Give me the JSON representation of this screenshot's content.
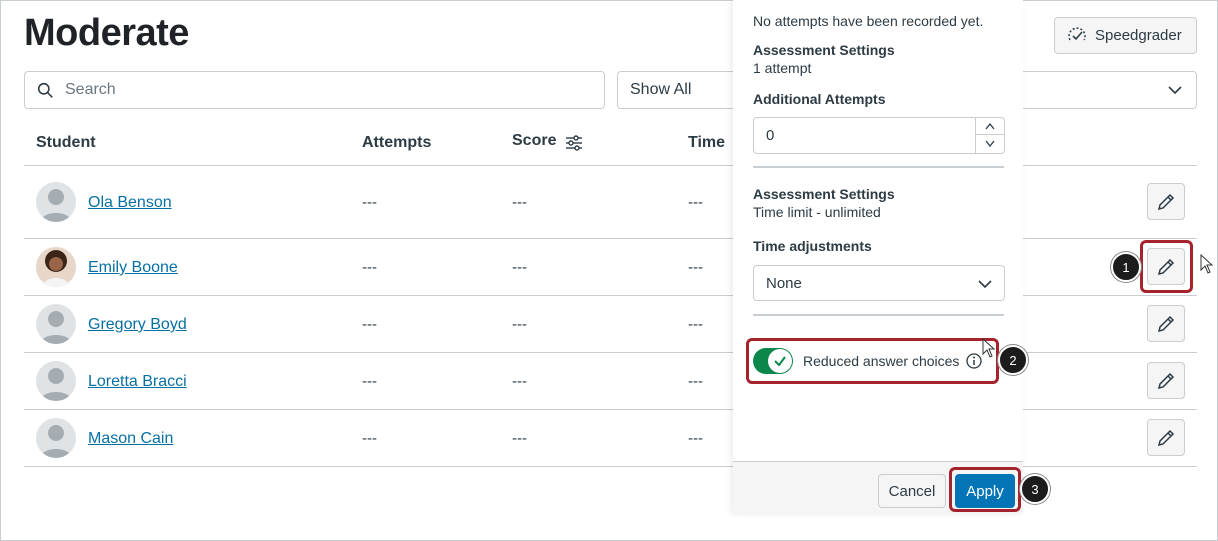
{
  "page": {
    "title": "Moderate"
  },
  "search": {
    "placeholder": "Search"
  },
  "filter": {
    "selected": "Show All"
  },
  "speedgrader": {
    "label": "Speedgrader"
  },
  "table": {
    "headers": {
      "student": "Student",
      "attempts": "Attempts",
      "score": "Score",
      "time": "Time"
    },
    "rows": [
      {
        "name": "Ola Benson",
        "attempts": "---",
        "score": "---",
        "time": "---",
        "avatar": "default"
      },
      {
        "name": "Emily Boone",
        "attempts": "---",
        "score": "---",
        "time": "---",
        "avatar": "photo"
      },
      {
        "name": "Gregory Boyd",
        "attempts": "---",
        "score": "---",
        "time": "---",
        "avatar": "default"
      },
      {
        "name": "Loretta Bracci",
        "attempts": "---",
        "score": "---",
        "time": "---",
        "avatar": "default"
      },
      {
        "name": "Mason Cain",
        "attempts": "---",
        "score": "---",
        "time": "---",
        "avatar": "default"
      }
    ]
  },
  "tray": {
    "no_attempts": "No attempts have been recorded yet.",
    "assessment_settings_1": "Assessment Settings",
    "attempt_count": "1 attempt",
    "additional_attempts_label": "Additional Attempts",
    "additional_attempts_value": "0",
    "assessment_settings_2": "Assessment Settings",
    "time_limit": "Time limit - unlimited",
    "time_adjustments_label": "Time adjustments",
    "time_adjustments_value": "None",
    "reduced_choices_label": "Reduced answer choices",
    "reduced_choices_enabled": true,
    "cancel_label": "Cancel",
    "apply_label": "Apply"
  },
  "callouts": [
    "1",
    "2",
    "3"
  ],
  "colors": {
    "highlight": "#a4232d",
    "link": "#0770a3",
    "apply": "#0374b5",
    "toggle_on": "#0b874b"
  }
}
